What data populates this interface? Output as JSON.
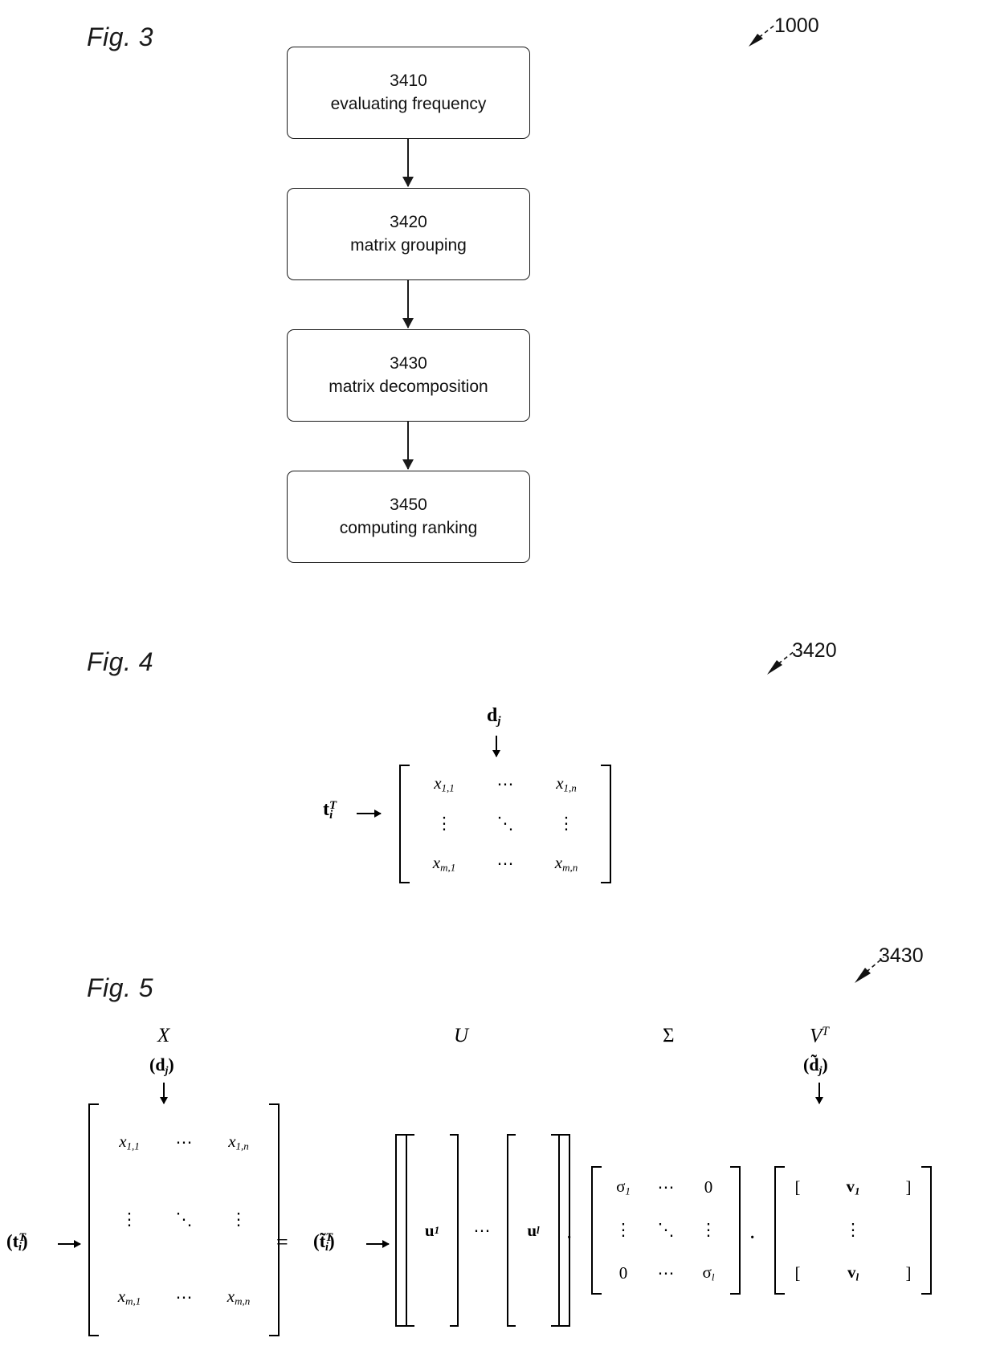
{
  "figures": [
    {
      "id": "fig3",
      "label": "Fig. 3",
      "reference": "1000",
      "type": "flowchart",
      "steps": [
        {
          "number": "3410",
          "text": "evaluating frequency"
        },
        {
          "number": "3420",
          "text": "matrix grouping"
        },
        {
          "number": "3430",
          "text": "matrix decomposition"
        },
        {
          "number": "3450",
          "text": "computing ranking"
        }
      ]
    },
    {
      "id": "fig4",
      "label": "Fig. 4",
      "reference": "3420",
      "type": "matrix-diagram",
      "column_label": "d",
      "column_label_sub": "j",
      "row_label": "t",
      "row_label_sub": "i",
      "row_label_sup": "T",
      "matrix": {
        "cells": [
          [
            "x",
            "1,1",
            "⋯",
            "x",
            "1,n"
          ],
          [
            "⋮",
            "",
            "⋱",
            "⋮",
            ""
          ],
          [
            "x",
            "m,1",
            "⋯",
            "x",
            "m,n"
          ]
        ],
        "r1c1": "x",
        "r1c1_sub": "1,1",
        "r1c2": "⋯",
        "r1c3": "x",
        "r1c3_sub": "1,n",
        "r2c1": "⋮",
        "r2c2": "⋱",
        "r2c3": "⋮",
        "r3c1": "x",
        "r3c1_sub": "m,1",
        "r3c2": "⋯",
        "r3c3": "x",
        "r3c3_sub": "m,n"
      }
    },
    {
      "id": "fig5",
      "label": "Fig. 5",
      "reference": "3430",
      "type": "equation",
      "headers": {
        "x": "X",
        "u": "U",
        "sigma": "Σ",
        "vt": "V",
        "vt_sup": "T"
      },
      "sublabels": {
        "left": "(d",
        "left_sub": "j",
        "left_close": ")",
        "right": "(d̃",
        "right_sub": "j",
        "right_close": ")"
      },
      "row_label_left": "(t",
      "row_label_left_sub": "i",
      "row_label_left_sup": "T",
      "row_label_left_close": ")",
      "row_label_mid": "(t̃",
      "row_label_mid_sub": "i",
      "row_label_mid_sup": "T",
      "row_label_mid_close": ")",
      "equals": "=",
      "dot1": "·",
      "dot2": "·",
      "x_matrix": {
        "r1c1": "x",
        "r1c1_sub": "1,1",
        "r1c2": "⋯",
        "r1c3": "x",
        "r1c3_sub": "1,n",
        "r2c1": "⋮",
        "r2c2": "⋱",
        "r2c3": "⋮",
        "r3c1": "x",
        "r3c1_sub": "m,1",
        "r3c2": "⋯",
        "r3c3": "x",
        "r3c3_sub": "m,n"
      },
      "u_matrix": {
        "col1": "u",
        "col1_sub": "1",
        "mid": "⋯",
        "col2": "u",
        "col2_sub": "l"
      },
      "sigma_matrix": {
        "r1c1": "σ",
        "r1c1_sub": "1",
        "r1c2": "⋯",
        "r1c3": "0",
        "r2c1": "⋮",
        "r2c2": "⋱",
        "r2c3": "⋮",
        "r3c1": "0",
        "r3c2": "⋯",
        "r3c3": "σ",
        "r3c3_sub": "l"
      },
      "v_matrix": {
        "r1": "v",
        "r1_sub": "1",
        "r2": "⋮",
        "r3": "v",
        "r3_sub": "l"
      }
    }
  ]
}
